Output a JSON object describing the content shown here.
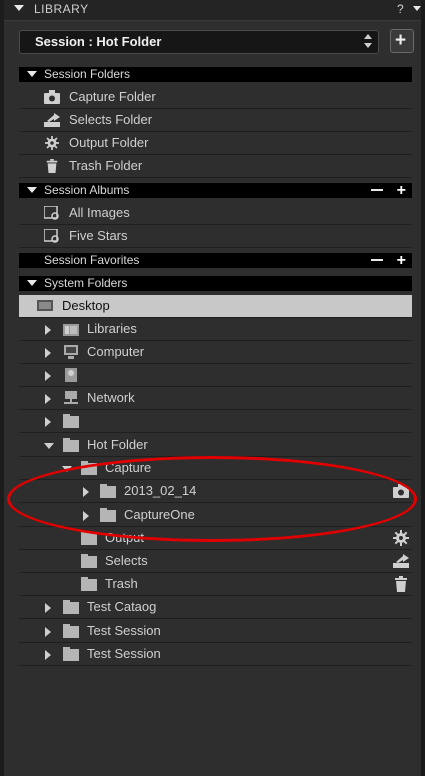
{
  "titlebar": {
    "title": "LIBRARY",
    "help": "?"
  },
  "session": {
    "label": "Session : Hot Folder"
  },
  "sections": {
    "session_folders": "Session Folders",
    "session_albums": "Session Albums",
    "session_favorites": "Session Favorites",
    "system_folders": "System Folders"
  },
  "session_folders": [
    "Capture Folder",
    "Selects Folder",
    "Output Folder",
    "Trash Folder"
  ],
  "session_albums": [
    "All Images",
    "Five Stars"
  ],
  "system_folders": {
    "desktop": "Desktop",
    "libraries": "Libraries",
    "computer": "Computer",
    "network": "Network",
    "hot_folder": "Hot Folder",
    "capture": "Capture",
    "date_folder": "2013_02_14",
    "captureone": "CaptureOne",
    "output": "Output",
    "selects": "Selects",
    "trash": "Trash",
    "test_cataog": "Test Cataog",
    "test_session_1": "Test Session",
    "test_session_2": "Test Session"
  },
  "colors": {
    "highlight_ellipse": "#e00000",
    "selected_row": "#c8c8c8",
    "section_bg": "#000000"
  }
}
